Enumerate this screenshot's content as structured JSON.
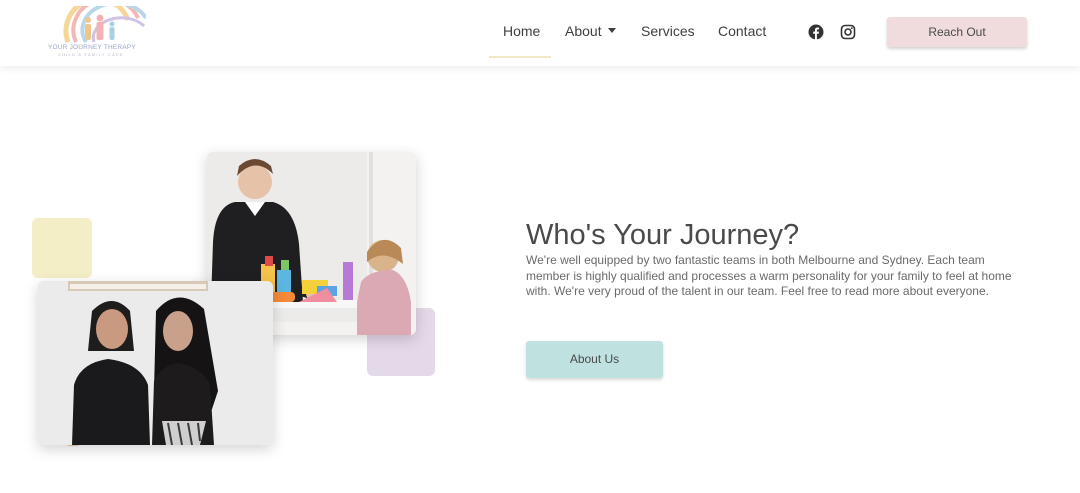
{
  "header": {
    "logo": {
      "brand": "YOUR JOURNEY THERAPY",
      "tagline": "CHILD & FAMILY CARE"
    },
    "nav": {
      "home": "Home",
      "about": "About",
      "services": "Services",
      "contact": "Contact"
    },
    "social": {
      "facebook_icon": "facebook-icon",
      "instagram_icon": "instagram-icon"
    },
    "cta_label": "Reach Out"
  },
  "section": {
    "heading": "Who's Your Journey?",
    "body": "We're well equipped by two fantastic teams in both Melbourne and Sydney. Each team member is highly qualified and processes a warm personality for your family to feel at home with. We're very proud of the talent in our team. Feel free to read more about everyone.",
    "button_label": "About Us"
  },
  "colors": {
    "reach_out_button": "#f0dcdc",
    "about_us_button": "#bfe1df",
    "yellow_square": "#f4eec7",
    "lilac_square": "#e4d9e8",
    "active_underline": "#f0e8c6",
    "heading_text": "#4a4a4a"
  }
}
